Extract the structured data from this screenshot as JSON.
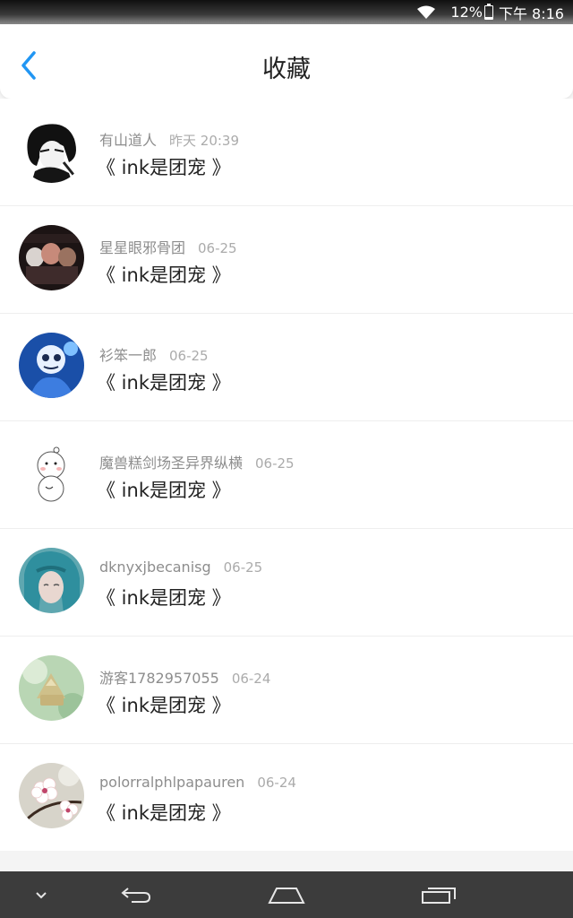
{
  "status_bar": {
    "battery": "12%",
    "time": "下午 8:16",
    "battery_level": 0.12,
    "icons": [
      "wifi-icon",
      "battery-icon"
    ]
  },
  "header": {
    "title": "收藏",
    "back_icon": "chevron-left-icon",
    "accent_color": "#2196f3"
  },
  "favorites": [
    {
      "user": "有山道人",
      "time": "昨天 20:39",
      "content": "《 ink是团宠 》",
      "avatar": "anime-boy-avatar"
    },
    {
      "user": "星星眼邪骨团",
      "time": "06-25",
      "content": "《 ink是团宠 》",
      "avatar": "group-avatar"
    },
    {
      "user": "衫笨一郎",
      "time": "06-25",
      "content": "《 ink是团宠 》",
      "avatar": "skeleton-avatar"
    },
    {
      "user": "魔兽糕剑场圣异界纵横",
      "time": "06-25",
      "content": "《 ink是团宠 》",
      "avatar": "snowman-avatar"
    },
    {
      "user": "dknyxjbecanisg",
      "time": "06-25",
      "content": "《 ink是团宠 》",
      "avatar": "teal-hair-avatar"
    },
    {
      "user": "游客1782957055",
      "time": "06-24",
      "content": "《 ink是团宠 》",
      "avatar": "badge-avatar"
    },
    {
      "user": "polorralphlpapauren",
      "time": "06-24",
      "content": "《 ink是团宠 》",
      "avatar": "flower-avatar"
    }
  ],
  "nav_bar": {
    "icons": [
      "collapse-icon",
      "back-icon",
      "home-icon",
      "recent-apps-icon"
    ]
  }
}
